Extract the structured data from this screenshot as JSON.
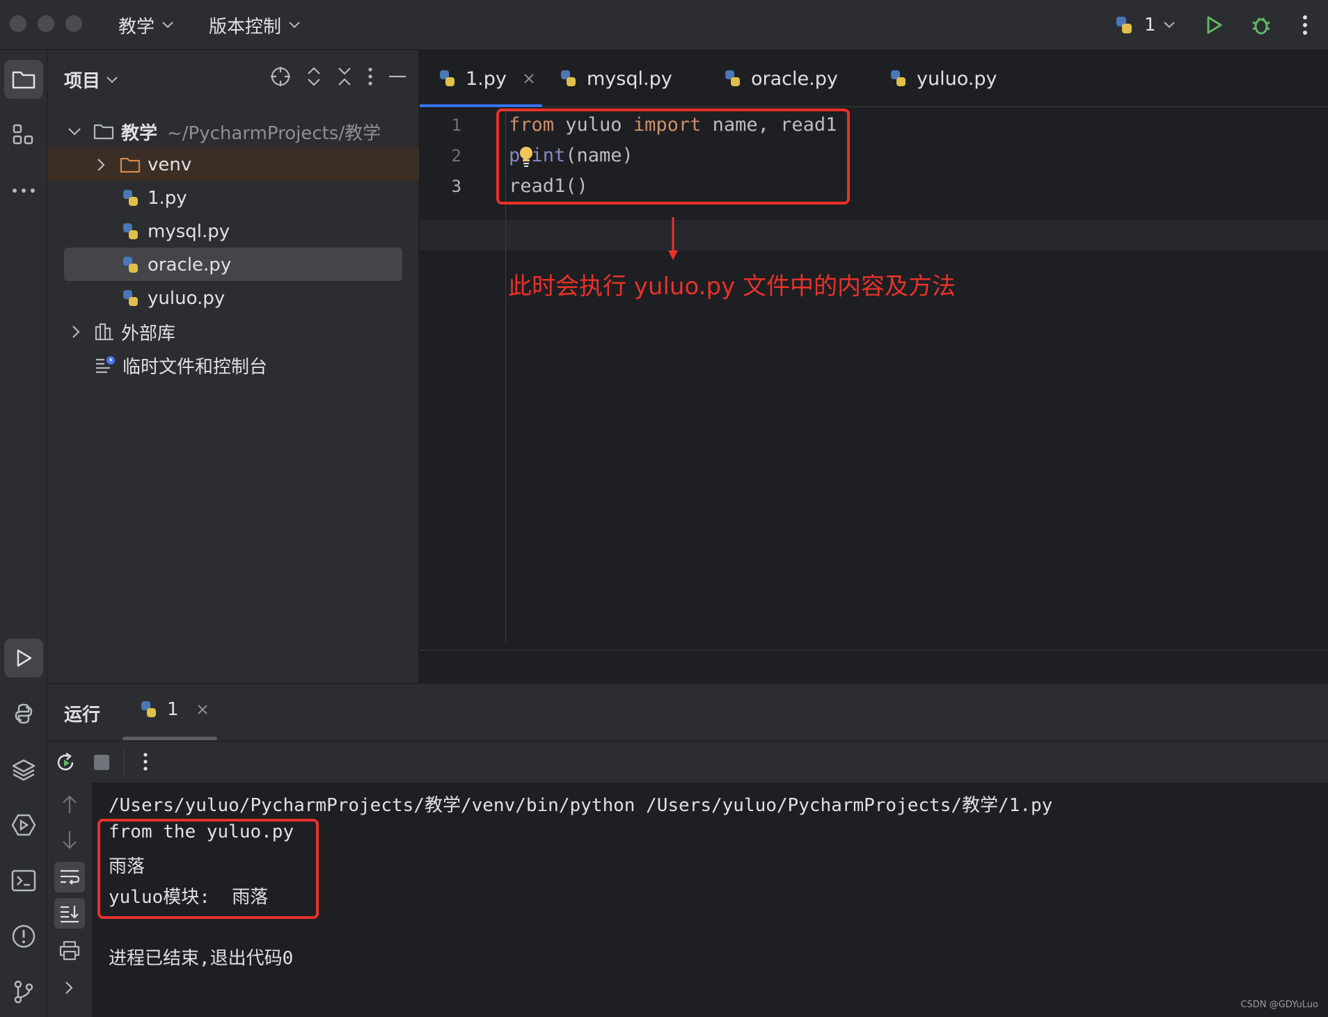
{
  "titlebar": {
    "project_menu": "教学",
    "vcs_menu": "版本控制",
    "run_config": "1"
  },
  "project_panel": {
    "title": "项目",
    "tree": {
      "root_name": "教学",
      "root_path": "~/PycharmProjects/教学",
      "venv": "venv",
      "files": [
        "1.py",
        "mysql.py",
        "oracle.py",
        "yuluo.py"
      ],
      "external_libs": "外部库",
      "scratches": "临时文件和控制台"
    }
  },
  "editor": {
    "tabs": [
      {
        "label": "1.py",
        "active": true
      },
      {
        "label": "mysql.py",
        "active": false
      },
      {
        "label": "oracle.py",
        "active": false
      },
      {
        "label": "yuluo.py",
        "active": false
      }
    ],
    "line_numbers": [
      "1",
      "2",
      "3"
    ],
    "code": {
      "line1_kw1": "from",
      "line1_mid": " yuluo ",
      "line1_kw2": "import",
      "line1_rest": " name, read1",
      "line2_fn": "print",
      "line2_rest": "(name)",
      "line3": "read1()"
    }
  },
  "annotation": {
    "text": "此时会执行 yuluo.py 文件中的内容及方法"
  },
  "run_panel": {
    "title": "运行",
    "tab_label": "1",
    "console": {
      "command": "/Users/yuluo/PycharmProjects/教学/venv/bin/python /Users/yuluo/PycharmProjects/教学/1.py",
      "output": [
        "from the yuluo.py",
        "雨落",
        "yuluo模块:  雨落"
      ],
      "exit_message": "进程已结束,退出代码0"
    }
  },
  "watermark": "CSDN @GDYuLuo",
  "colors": {
    "accent": "#3574f0",
    "annotation_red": "#e8322a",
    "run_green": "#5fb865",
    "keyword": "#cf8e6d",
    "builtin": "#8888c6"
  }
}
